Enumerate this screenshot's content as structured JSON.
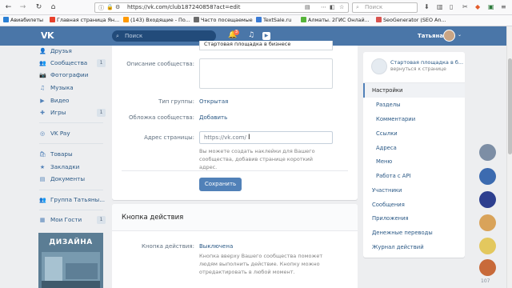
{
  "browser": {
    "url": "https://vk.com/club187240858?act=edit",
    "search_placeholder": "Поиск"
  },
  "bookmarks": [
    {
      "label": "Авиабилеты",
      "color": "#2a7fd4"
    },
    {
      "label": "Главная страница Ян...",
      "color": "#e8412b"
    },
    {
      "label": "(143) Входящие - По...",
      "color": "#ff9900"
    },
    {
      "label": "Часто посещаемые",
      "color": "#6b6b6b"
    },
    {
      "label": "TextSale.ru",
      "color": "#3a7bd5"
    },
    {
      "label": "Алматы. 2ГИС Онлай...",
      "color": "#56b43a"
    },
    {
      "label": "SeoGenerator (SEO An...",
      "color": "#d9534f"
    }
  ],
  "vk_header": {
    "logo": "VK",
    "search_placeholder": "Поиск",
    "notif_count": "3",
    "user_name": "Татьяна"
  },
  "sidebar": {
    "items": [
      {
        "label": "Друзья",
        "icon": "friends-icon",
        "glyph": "👤",
        "count": ""
      },
      {
        "label": "Сообщества",
        "icon": "communities-icon",
        "glyph": "👥",
        "count": "1"
      },
      {
        "label": "Фотографии",
        "icon": "photos-icon",
        "glyph": "📷",
        "count": ""
      },
      {
        "label": "Музыка",
        "icon": "music-icon",
        "glyph": "♫",
        "count": ""
      },
      {
        "label": "Видео",
        "icon": "video-icon",
        "glyph": "▶",
        "count": ""
      },
      {
        "label": "Игры",
        "icon": "games-icon",
        "glyph": "✚",
        "count": "1"
      },
      {
        "label": "VK Pay",
        "icon": "vkpay-icon",
        "glyph": "◎",
        "count": ""
      },
      {
        "label": "Товары",
        "icon": "goods-icon",
        "glyph": "🛍",
        "count": ""
      },
      {
        "label": "Закладки",
        "icon": "bookmarks-icon",
        "glyph": "★",
        "count": ""
      },
      {
        "label": "Документы",
        "icon": "documents-icon",
        "glyph": "▤",
        "count": ""
      },
      {
        "label": "Группа Татьяны...",
        "icon": "group-icon",
        "glyph": "👥",
        "count": ""
      },
      {
        "label": "Мои Гости",
        "icon": "guests-icon",
        "glyph": "▦",
        "count": "1"
      }
    ],
    "ad_title": "ДИЗАЙНА"
  },
  "form": {
    "top_value": "Стартовая площадка в бизнесе",
    "description_label": "Описание сообщества:",
    "type_label": "Тип группы:",
    "type_value": "Открытая",
    "cover_label": "Обложка сообщества:",
    "cover_value": "Добавить",
    "address_label": "Адрес страницы:",
    "address_placeholder": "https://vk.com/",
    "address_hint": "Вы можете создать наклейки для Вашего сообщества, добавив странице короткий адрес.",
    "save_label": "Сохранить"
  },
  "action_button": {
    "title": "Кнопка действия",
    "label": "Кнопка действия:",
    "value": "Выключена",
    "hint": "Кнопка вверху Вашего сообщества поможет людям выполнить действие. Кнопку можно отредактировать в любой момент."
  },
  "right_panel": {
    "group_title": "Стартовая площадка в б...",
    "group_sub": "вернуться к странице",
    "menu": [
      {
        "label": "Настройки",
        "sub": false,
        "active": true
      },
      {
        "label": "Разделы",
        "sub": true,
        "active": false
      },
      {
        "label": "Комментарии",
        "sub": true,
        "active": false
      },
      {
        "label": "Ссылки",
        "sub": true,
        "active": false
      },
      {
        "label": "Адреса",
        "sub": true,
        "active": false
      },
      {
        "label": "Меню",
        "sub": true,
        "active": false
      },
      {
        "label": "Работа с API",
        "sub": true,
        "active": false
      },
      {
        "label": "Участники",
        "sub": false,
        "active": false
      },
      {
        "label": "Сообщения",
        "sub": false,
        "active": false
      },
      {
        "label": "Приложения",
        "sub": false,
        "active": false
      },
      {
        "label": "Денежные переводы",
        "sub": false,
        "active": false
      },
      {
        "label": "Журнал действий",
        "sub": false,
        "active": false
      }
    ]
  },
  "friends_online": {
    "count": "107",
    "colors": [
      "#7d8ea5",
      "#3c6bb0",
      "#2d3f8f",
      "#d9a35a",
      "#e3c85e",
      "#c86a3a",
      "#8a6b5a"
    ]
  }
}
